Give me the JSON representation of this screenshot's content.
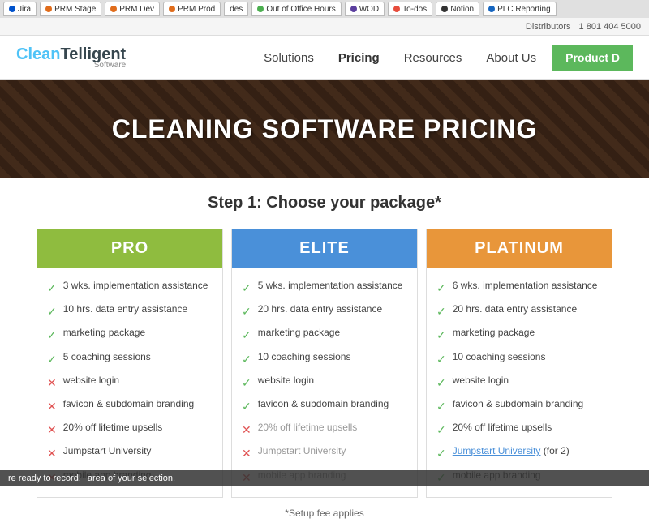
{
  "tabs_bar": {
    "tabs": [
      {
        "label": "Jira",
        "color": "#0052cc"
      },
      {
        "label": "PRM Stage",
        "color": "#e06c1b"
      },
      {
        "label": "PRM Dev",
        "color": "#e06c1b"
      },
      {
        "label": "PRM Prod",
        "color": "#e06c1b"
      },
      {
        "label": "des",
        "color": "#888"
      },
      {
        "label": "Out of Office Hours",
        "color": "#4caf50"
      },
      {
        "label": "WOD",
        "color": "#5b3e9e"
      },
      {
        "label": "To-dos",
        "color": "#e74c3c"
      },
      {
        "label": "Notion",
        "color": "#333"
      },
      {
        "label": "PLC Reporting",
        "color": "#1565c0"
      }
    ]
  },
  "utility_bar": {
    "distributor_label": "Distributors",
    "phone": "1 801 404 5000"
  },
  "nav": {
    "logo_clean": "Clean",
    "logo_telligent": "Telligent",
    "logo_software": "Software",
    "links": [
      {
        "label": "Solutions",
        "active": false
      },
      {
        "label": "Pricing",
        "active": true
      },
      {
        "label": "Resources",
        "active": false
      },
      {
        "label": "About Us",
        "active": false
      }
    ],
    "cta_button": "Product D"
  },
  "hero": {
    "title": "CLEANING SOFTWARE PRICING"
  },
  "pricing": {
    "step_title": "Step 1: Choose your package*",
    "packages": [
      {
        "name": "PRO",
        "header_class": "header-pro",
        "features": [
          {
            "icon": "check",
            "text": "3 wks. implementation assistance"
          },
          {
            "icon": "check",
            "text": "10 hrs. data entry assistance"
          },
          {
            "icon": "check",
            "text": "marketing package"
          },
          {
            "icon": "check",
            "text": "5 coaching sessions"
          },
          {
            "icon": "x",
            "text": "website login"
          },
          {
            "icon": "x",
            "text": "favicon & subdomain branding"
          },
          {
            "icon": "x",
            "text": "20% off lifetime upsells"
          },
          {
            "icon": "x",
            "text": "Jumpstart University"
          },
          {
            "icon": "x",
            "text": "mobile app branding"
          }
        ]
      },
      {
        "name": "ELITE",
        "header_class": "header-elite",
        "features": [
          {
            "icon": "check",
            "text": "5 wks. implementation assistance"
          },
          {
            "icon": "check",
            "text": "20 hrs. data entry assistance"
          },
          {
            "icon": "check",
            "text": "marketing package"
          },
          {
            "icon": "check",
            "text": "10 coaching sessions"
          },
          {
            "icon": "check",
            "text": "website login"
          },
          {
            "icon": "check",
            "text": "favicon & subdomain branding"
          },
          {
            "icon": "x",
            "text": "20% off lifetime upsells",
            "muted": true
          },
          {
            "icon": "x",
            "text": "Jumpstart University",
            "muted": true
          },
          {
            "icon": "x",
            "text": "mobile app branding",
            "muted": true
          }
        ]
      },
      {
        "name": "PLATINUM",
        "header_class": "header-platinum",
        "features": [
          {
            "icon": "check",
            "text": "6 wks. implementation assistance"
          },
          {
            "icon": "check",
            "text": "20 hrs. data entry assistance"
          },
          {
            "icon": "check",
            "text": "marketing package"
          },
          {
            "icon": "check",
            "text": "10 coaching sessions"
          },
          {
            "icon": "check",
            "text": "website login"
          },
          {
            "icon": "check",
            "text": "favicon & subdomain branding"
          },
          {
            "icon": "check",
            "text": "20% off lifetime upsells"
          },
          {
            "icon": "check",
            "text": "Jumpstart University (for 2)",
            "link": true,
            "link_text": "Jumpstart University",
            "suffix": " (for 2)"
          },
          {
            "icon": "check",
            "text": "mobile app branding"
          }
        ]
      }
    ],
    "setup_note": "*Setup fee applies"
  },
  "bottom_bar": {
    "text": "re ready to record!",
    "sub": "area of your selection."
  }
}
